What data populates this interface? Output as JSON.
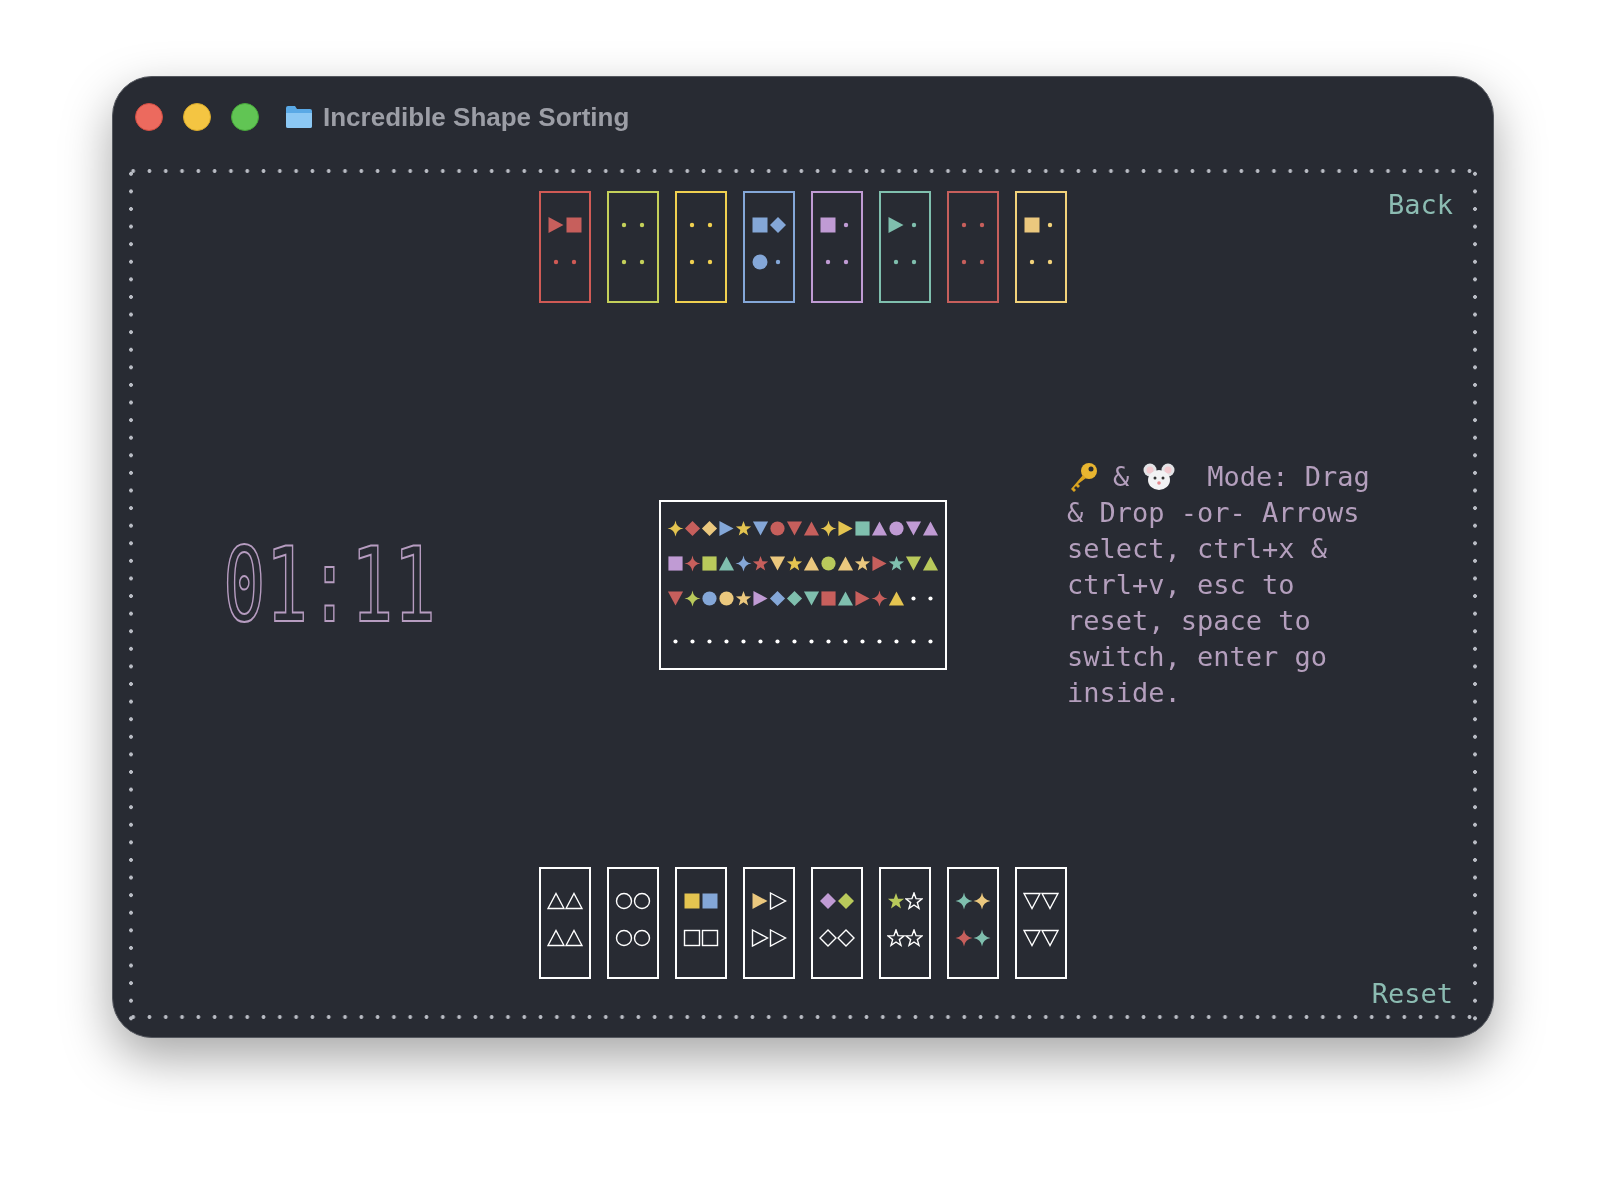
{
  "window": {
    "title": "Incredible Shape Sorting"
  },
  "back": "Back",
  "timer": "01:11",
  "top_bins": [
    {
      "color": "#d05a55",
      "slots": [
        {
          "kind": "triangle-right",
          "color": "#c75f5c"
        },
        {
          "kind": "square",
          "color": "#c75f5c"
        },
        {
          "kind": "empty"
        },
        {
          "kind": "empty"
        }
      ]
    },
    {
      "color": "#c4d05a",
      "slots": [
        {
          "kind": "empty"
        },
        {
          "kind": "empty"
        },
        {
          "kind": "empty"
        },
        {
          "kind": "empty"
        }
      ]
    },
    {
      "color": "#f0d050",
      "slots": [
        {
          "kind": "empty"
        },
        {
          "kind": "empty"
        },
        {
          "kind": "empty"
        },
        {
          "kind": "empty"
        }
      ]
    },
    {
      "color": "#84a7d8",
      "slots": [
        {
          "kind": "square",
          "color": "#84a7d8"
        },
        {
          "kind": "diamond",
          "color": "#84a7d8"
        },
        {
          "kind": "circle",
          "color": "#84a7d8"
        },
        {
          "kind": "empty"
        }
      ]
    },
    {
      "color": "#c09bd4",
      "slots": [
        {
          "kind": "square",
          "color": "#c09bd4"
        },
        {
          "kind": "empty"
        },
        {
          "kind": "empty"
        },
        {
          "kind": "empty"
        }
      ]
    },
    {
      "color": "#7fbfae",
      "slots": [
        {
          "kind": "triangle-right",
          "color": "#7fbfae"
        },
        {
          "kind": "empty"
        },
        {
          "kind": "empty"
        },
        {
          "kind": "empty"
        }
      ]
    },
    {
      "color": "#c75f5c",
      "slots": [
        {
          "kind": "empty"
        },
        {
          "kind": "empty"
        },
        {
          "kind": "empty"
        },
        {
          "kind": "empty"
        }
      ]
    },
    {
      "color": "#f2d27a",
      "slots": [
        {
          "kind": "square",
          "color": "#ebc87e"
        },
        {
          "kind": "empty"
        },
        {
          "kind": "empty"
        },
        {
          "kind": "empty"
        }
      ]
    }
  ],
  "pool": {
    "rows": [
      [
        {
          "kind": "sparkle",
          "color": "#e4c450"
        },
        {
          "kind": "diamond",
          "color": "#c75f5c"
        },
        {
          "kind": "diamond",
          "color": "#ebc87e"
        },
        {
          "kind": "triangle-right",
          "color": "#84a7d8"
        },
        {
          "kind": "star",
          "color": "#e4c450"
        },
        {
          "kind": "triangle-down",
          "color": "#84a7d8"
        },
        {
          "kind": "circle",
          "color": "#c75f5c"
        },
        {
          "kind": "triangle-down",
          "color": "#c75f5c"
        },
        {
          "kind": "triangle-up",
          "color": "#c75f5c"
        },
        {
          "kind": "sparkle",
          "color": "#e4c450"
        },
        {
          "kind": "triangle-right",
          "color": "#e4c450"
        },
        {
          "kind": "square",
          "color": "#7fbfae"
        },
        {
          "kind": "triangle-up",
          "color": "#c09bd4"
        },
        {
          "kind": "circle",
          "color": "#c09bd4"
        },
        {
          "kind": "triangle-down",
          "color": "#c09bd4"
        },
        {
          "kind": "triangle-up",
          "color": "#c09bd4"
        }
      ],
      [
        {
          "kind": "square",
          "color": "#c09bd4"
        },
        {
          "kind": "sparkle",
          "color": "#c75f5c"
        },
        {
          "kind": "square",
          "color": "#b9c95b"
        },
        {
          "kind": "triangle-up",
          "color": "#7fbfae"
        },
        {
          "kind": "sparkle",
          "color": "#84a7d8"
        },
        {
          "kind": "star",
          "color": "#c75f5c"
        },
        {
          "kind": "triangle-down",
          "color": "#ebc87e"
        },
        {
          "kind": "star",
          "color": "#e4c450"
        },
        {
          "kind": "triangle-up",
          "color": "#ebc87e"
        },
        {
          "kind": "circle",
          "color": "#b9c95b"
        },
        {
          "kind": "triangle-up",
          "color": "#ebc87e"
        },
        {
          "kind": "star",
          "color": "#ebc87e"
        },
        {
          "kind": "triangle-right",
          "color": "#c75f5c"
        },
        {
          "kind": "star",
          "color": "#7fbfae"
        },
        {
          "kind": "triangle-down",
          "color": "#b9c95b"
        },
        {
          "kind": "triangle-up",
          "color": "#b9c95b"
        }
      ],
      [
        {
          "kind": "triangle-down",
          "color": "#c75f5c"
        },
        {
          "kind": "sparkle",
          "color": "#b9c95b"
        },
        {
          "kind": "circle",
          "color": "#84a7d8"
        },
        {
          "kind": "circle",
          "color": "#ebc87e"
        },
        {
          "kind": "star",
          "color": "#ebc87e"
        },
        {
          "kind": "triangle-right",
          "color": "#c09bd4"
        },
        {
          "kind": "diamond",
          "color": "#84a7d8"
        },
        {
          "kind": "diamond",
          "color": "#7fbfae"
        },
        {
          "kind": "triangle-down",
          "color": "#7fbfae"
        },
        {
          "kind": "square",
          "color": "#c75f5c"
        },
        {
          "kind": "triangle-up",
          "color": "#7fbfae"
        },
        {
          "kind": "triangle-right",
          "color": "#c75f5c"
        },
        {
          "kind": "sparkle",
          "color": "#c75f5c"
        },
        {
          "kind": "triangle-up",
          "color": "#e4c450"
        },
        {
          "kind": "empty"
        },
        {
          "kind": "empty"
        }
      ],
      [
        {
          "kind": "empty"
        },
        {
          "kind": "empty"
        },
        {
          "kind": "empty"
        },
        {
          "kind": "empty"
        },
        {
          "kind": "empty"
        },
        {
          "kind": "empty"
        },
        {
          "kind": "empty"
        },
        {
          "kind": "empty"
        },
        {
          "kind": "empty"
        },
        {
          "kind": "empty"
        },
        {
          "kind": "empty"
        },
        {
          "kind": "empty"
        },
        {
          "kind": "empty"
        },
        {
          "kind": "empty"
        },
        {
          "kind": "empty"
        },
        {
          "kind": "empty"
        }
      ]
    ]
  },
  "help": {
    "joiner": "&",
    "first_line": "Mode: Drag",
    "text": "& Drop -or- Arrows select, ctrl+x & ctrl+v, esc to reset, space to switch, enter go inside."
  },
  "target_bins": [
    {
      "slots": [
        {
          "kind": "triangle-up",
          "filled": false
        },
        {
          "kind": "triangle-up",
          "filled": false
        },
        {
          "kind": "triangle-up",
          "filled": false
        },
        {
          "kind": "triangle-up",
          "filled": false
        }
      ]
    },
    {
      "slots": [
        {
          "kind": "circle",
          "filled": false
        },
        {
          "kind": "circle",
          "filled": false
        },
        {
          "kind": "circle",
          "filled": false
        },
        {
          "kind": "circle",
          "filled": false
        }
      ]
    },
    {
      "slots": [
        {
          "kind": "square",
          "filled": true,
          "color": "#e4c450"
        },
        {
          "kind": "square",
          "filled": true,
          "color": "#84a7d8"
        },
        {
          "kind": "square",
          "filled": false
        },
        {
          "kind": "square",
          "filled": false
        }
      ]
    },
    {
      "slots": [
        {
          "kind": "triangle-right",
          "filled": true,
          "color": "#ebc87e"
        },
        {
          "kind": "triangle-right",
          "filled": false
        },
        {
          "kind": "triangle-right",
          "filled": false
        },
        {
          "kind": "triangle-right",
          "filled": false
        }
      ]
    },
    {
      "slots": [
        {
          "kind": "diamond",
          "filled": true,
          "color": "#c09bd4"
        },
        {
          "kind": "diamond",
          "filled": true,
          "color": "#b9c95b"
        },
        {
          "kind": "diamond",
          "filled": false
        },
        {
          "kind": "diamond",
          "filled": false
        }
      ]
    },
    {
      "slots": [
        {
          "kind": "star",
          "filled": true,
          "color": "#b9c95b"
        },
        {
          "kind": "star",
          "filled": false
        },
        {
          "kind": "star",
          "filled": false
        },
        {
          "kind": "star",
          "filled": false
        }
      ]
    },
    {
      "slots": [
        {
          "kind": "sparkle",
          "filled": true,
          "color": "#7fbfae"
        },
        {
          "kind": "sparkle",
          "filled": true,
          "color": "#ebc87e"
        },
        {
          "kind": "sparkle",
          "filled": true,
          "color": "#c75f5c"
        },
        {
          "kind": "sparkle",
          "filled": true,
          "color": "#7fbfae"
        }
      ]
    },
    {
      "slots": [
        {
          "kind": "triangle-down",
          "filled": false
        },
        {
          "kind": "triangle-down",
          "filled": false
        },
        {
          "kind": "triangle-down",
          "filled": false
        },
        {
          "kind": "triangle-down",
          "filled": false
        }
      ]
    }
  ],
  "reset": "Reset"
}
